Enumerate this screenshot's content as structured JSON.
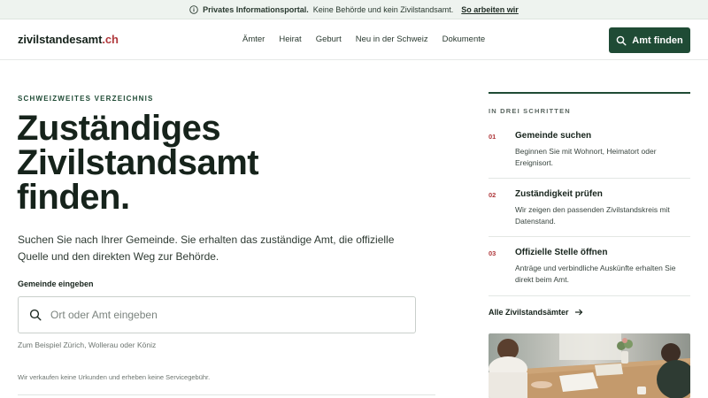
{
  "banner": {
    "strong": "Privates Informationsportal.",
    "text": "Keine Behörde und kein Zivilstandsamt.",
    "link": "So arbeiten wir"
  },
  "header": {
    "logo_main": "zivilstandesamt",
    "logo_tld": ".ch",
    "nav": [
      "Ämter",
      "Heirat",
      "Geburt",
      "Neu in der Schweiz",
      "Dokumente"
    ],
    "cta_label": "Amt finden"
  },
  "main": {
    "eyebrow": "SCHWEIZWEITES VERZEICHNIS",
    "headline_line1": "Zuständiges",
    "headline_line2": "Zivilstandsamt",
    "headline_line3": "finden.",
    "lede": "Suchen Sie nach Ihrer Gemeinde. Sie erhalten das zuständige Amt, die offizielle Quelle und den direkten Weg zur Behörde.",
    "field_label": "Gemeinde eingeben",
    "search_placeholder": "Ort oder Amt eingeben",
    "search_value": "",
    "hint": "Zum Beispiel Zürich, Wollerau oder Köniz",
    "disclaimer": "Wir verkaufen keine Urkunden und erheben keine Servicegebühr."
  },
  "steps": {
    "eyebrow": "IN DREI SCHRITTEN",
    "items": [
      {
        "num": "01",
        "title": "Gemeinde suchen",
        "desc": "Beginnen Sie mit Wohnort, Heimatort oder Ereignisort."
      },
      {
        "num": "02",
        "title": "Zuständigkeit prüfen",
        "desc": "Wir zeigen den passenden Zivilstandskreis mit Datenstand."
      },
      {
        "num": "03",
        "title": "Offizielle Stelle öffnen",
        "desc": "Anträge und verbindliche Auskünfte erhalten Sie direkt beim Amt."
      }
    ],
    "all_link": "Alle Zivilstandsämter"
  },
  "colors": {
    "brand_green": "#1f4b35",
    "accent_red": "#b0393c",
    "banner_bg": "#eef3ef"
  },
  "icons": {
    "banner": "info-icon",
    "cta": "search-icon",
    "search": "search-icon",
    "all_link": "arrow-right-icon"
  }
}
